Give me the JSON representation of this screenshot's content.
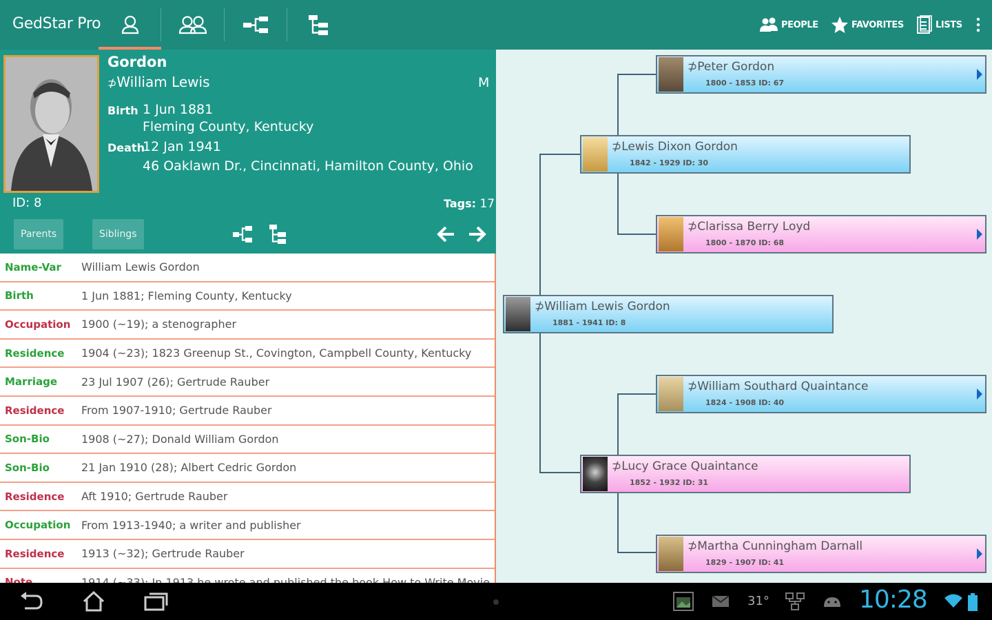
{
  "app": {
    "title": "GedStar Pro"
  },
  "actionbar": {
    "tabs": [
      {
        "icon": "person-icon",
        "selected": true
      },
      {
        "icon": "family-icon",
        "selected": false
      },
      {
        "icon": "pedigree-icon",
        "selected": false
      },
      {
        "icon": "descendants-icon",
        "selected": false
      }
    ],
    "actions": [
      {
        "label": "PEOPLE",
        "icon": "people-icon"
      },
      {
        "label": "FAVORITES",
        "icon": "star-icon"
      },
      {
        "label": "LISTS",
        "icon": "lists-icon"
      }
    ],
    "overflow_icon": "overflow-menu-icon"
  },
  "person": {
    "surname": "Gordon",
    "given": "William Lewis",
    "sex": "M",
    "birth_label": "Birth",
    "birth_date": "1 Jun 1881",
    "birth_place": "Fleming County, Kentucky",
    "death_label": "Death",
    "death_date": "12 Jan 1941",
    "death_place": "46 Oaklawn Dr., Cincinnati, Hamilton County, Ohio",
    "id": "ID: 8",
    "tags_label": "Tags:",
    "tags_value": "17",
    "buttons": {
      "parents": "Parents",
      "siblings": "Siblings"
    }
  },
  "facts": [
    {
      "label": "Name-Var",
      "value": "William Lewis Gordon",
      "color": "green"
    },
    {
      "label": "Birth",
      "value": "1 Jun 1881; Fleming County, Kentucky",
      "color": "green"
    },
    {
      "label": "Occupation",
      "value": "1900 (~19); a stenographer",
      "color": "red"
    },
    {
      "label": "Residence",
      "value": "1904 (~23); 1823 Greenup St., Covington, Campbell County, Kentucky",
      "color": "green"
    },
    {
      "label": "Marriage",
      "value": "23 Jul 1907 (26); Gertrude Rauber",
      "color": "green"
    },
    {
      "label": "Residence",
      "value": "From 1907-1910; Gertrude Rauber",
      "color": "red"
    },
    {
      "label": "Son-Bio",
      "value": "1908 (~27); Donald William Gordon",
      "color": "green"
    },
    {
      "label": "Son-Bio",
      "value": "21 Jan 1910 (28); Albert Cedric Gordon",
      "color": "green"
    },
    {
      "label": "Residence",
      "value": "Aft 1910; Gertrude Rauber",
      "color": "red"
    },
    {
      "label": "Occupation",
      "value": "From 1913-1940; a writer and publisher",
      "color": "green"
    },
    {
      "label": "Residence",
      "value": "1913 (~32); Gertrude Rauber",
      "color": "red"
    },
    {
      "label": "Note",
      "value": "1914 (~33); In 1913 he wrote and published the book How to Write Movie",
      "color": "red"
    }
  ],
  "tree": {
    "people": [
      {
        "name": "Peter Gordon",
        "dates": "1800 - 1853  ID: 67",
        "sex": "male",
        "more": true
      },
      {
        "name": "Lewis Dixon Gordon",
        "dates": "1842 - 1929  ID: 30",
        "sex": "male",
        "more": false
      },
      {
        "name": "Clarissa Berry Loyd",
        "dates": "1800 - 1870  ID: 68",
        "sex": "female",
        "more": true
      },
      {
        "name": "William Lewis Gordon",
        "dates": "1881 - 1941  ID: 8",
        "sex": "male",
        "more": false
      },
      {
        "name": "William Southard Quaintance",
        "dates": "1824 - 1908  ID: 40",
        "sex": "male",
        "more": true
      },
      {
        "name": "Lucy Grace Quaintance",
        "dates": "1852 - 1932  ID: 31",
        "sex": "female",
        "more": false
      },
      {
        "name": "Martha Cunningham Darnall",
        "dates": "1829 - 1907  ID: 41",
        "sex": "female",
        "more": true
      }
    ]
  },
  "navbar": {
    "temperature": "31°",
    "clock": "10:28"
  },
  "colors": {
    "actionbar": "#1d8a7c",
    "header": "#1d9788",
    "accent": "#ff8a65",
    "male_box": "#7dd2f4",
    "female_box": "#f7a8e7",
    "label_green": "#2aa23a",
    "label_red": "#c0304a",
    "clock": "#33b5e5"
  }
}
